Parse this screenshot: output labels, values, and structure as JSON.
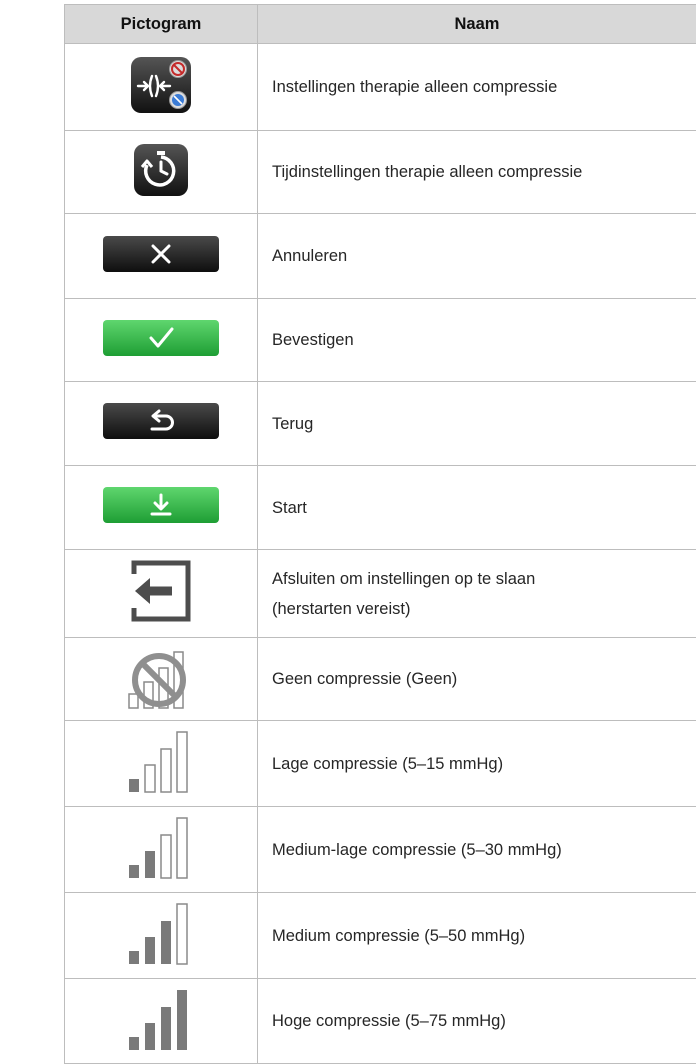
{
  "header": {
    "col_pictogram": "Pictogram",
    "col_name": "Naam"
  },
  "rows": [
    {
      "icon": "compression-therapy-settings-icon",
      "name": "Instellingen therapie alleen compressie"
    },
    {
      "icon": "timer-settings-icon",
      "name": "Tijdinstellingen therapie alleen compressie"
    },
    {
      "icon": "cancel-x-icon",
      "name": "Annuleren"
    },
    {
      "icon": "confirm-check-icon",
      "name": "Bevestigen"
    },
    {
      "icon": "back-arrow-icon",
      "name": "Terug"
    },
    {
      "icon": "start-download-icon",
      "name": "Start"
    },
    {
      "icon": "exit-door-icon",
      "name": "Afsluiten om instellingen op te slaan (herstarten vereist)"
    },
    {
      "icon": "no-compression-icon",
      "name": "Geen compressie (Geen)"
    },
    {
      "icon": "compression-level-1-icon",
      "name": "Lage compressie (5–15 mmHg)",
      "level": 1
    },
    {
      "icon": "compression-level-2-icon",
      "name": "Medium-lage compressie (5–30 mmHg)",
      "level": 2
    },
    {
      "icon": "compression-level-3-icon",
      "name": "Medium compressie (5–50 mmHg)",
      "level": 3
    },
    {
      "icon": "compression-level-4-icon",
      "name": "Hoge compressie (5–75 mmHg)",
      "level": 4
    }
  ],
  "colors": {
    "header_bg": "#d8d8d8",
    "dark_button": "#1c1c1c",
    "green_button": "#2fb545",
    "bar_fill": "#7a7a7a"
  }
}
